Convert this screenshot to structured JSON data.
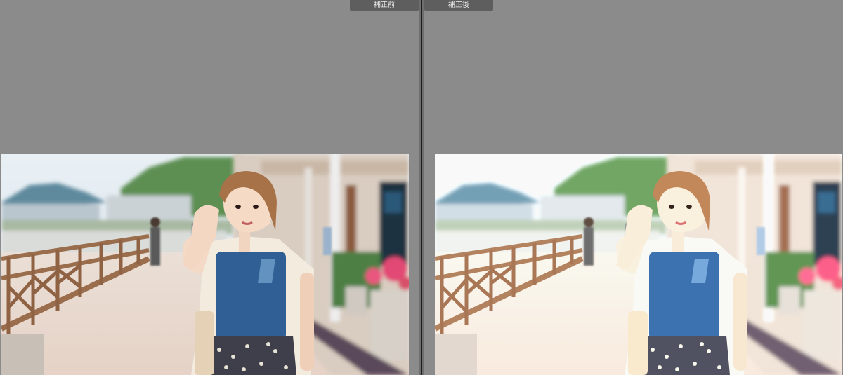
{
  "compare_view": {
    "before_label": "補正前",
    "after_label": "補正後"
  },
  "colors": {
    "background": "#8b8b8b",
    "label_bg": "#5e5e5e",
    "divider": "#1e1e1e"
  }
}
